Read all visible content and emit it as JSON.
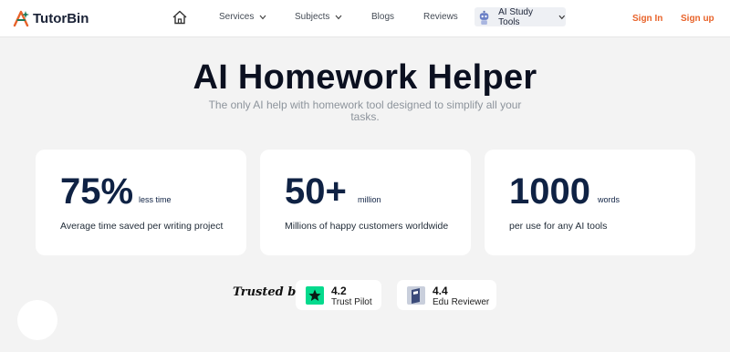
{
  "brand": {
    "name": "TutorBin",
    "accent": "#e8632a",
    "navy": "#0f2244"
  },
  "nav": {
    "home_icon": "home-icon",
    "services": "Services",
    "subjects": "Subjects",
    "blogs": "Blogs",
    "reviews": "Reviews",
    "ai_tools": "AI Study Tools",
    "sign_in": "Sign In",
    "sign_up": "Sign up"
  },
  "hero": {
    "title": "AI Homework Helper",
    "subtitle": "The only AI help with homework tool designed to simplify all your tasks."
  },
  "stats": [
    {
      "value": "75%",
      "unit": "less time",
      "description": "Average time saved per writing project"
    },
    {
      "value": "50+",
      "unit": "million",
      "description": "Millions of happy customers worldwide"
    },
    {
      "value": "1000",
      "unit": "words",
      "description": "per use for any AI tools"
    }
  ],
  "trusted": {
    "label": "Trusted by",
    "badges": [
      {
        "rating": "4.2",
        "name": "Trust Pilot",
        "icon": "trustpilot-star-icon",
        "color": "#04da8d"
      },
      {
        "rating": "4.4",
        "name": "Edu Reviewer",
        "icon": "edureviewer-icon",
        "color": "#3b4b7a"
      }
    ]
  }
}
